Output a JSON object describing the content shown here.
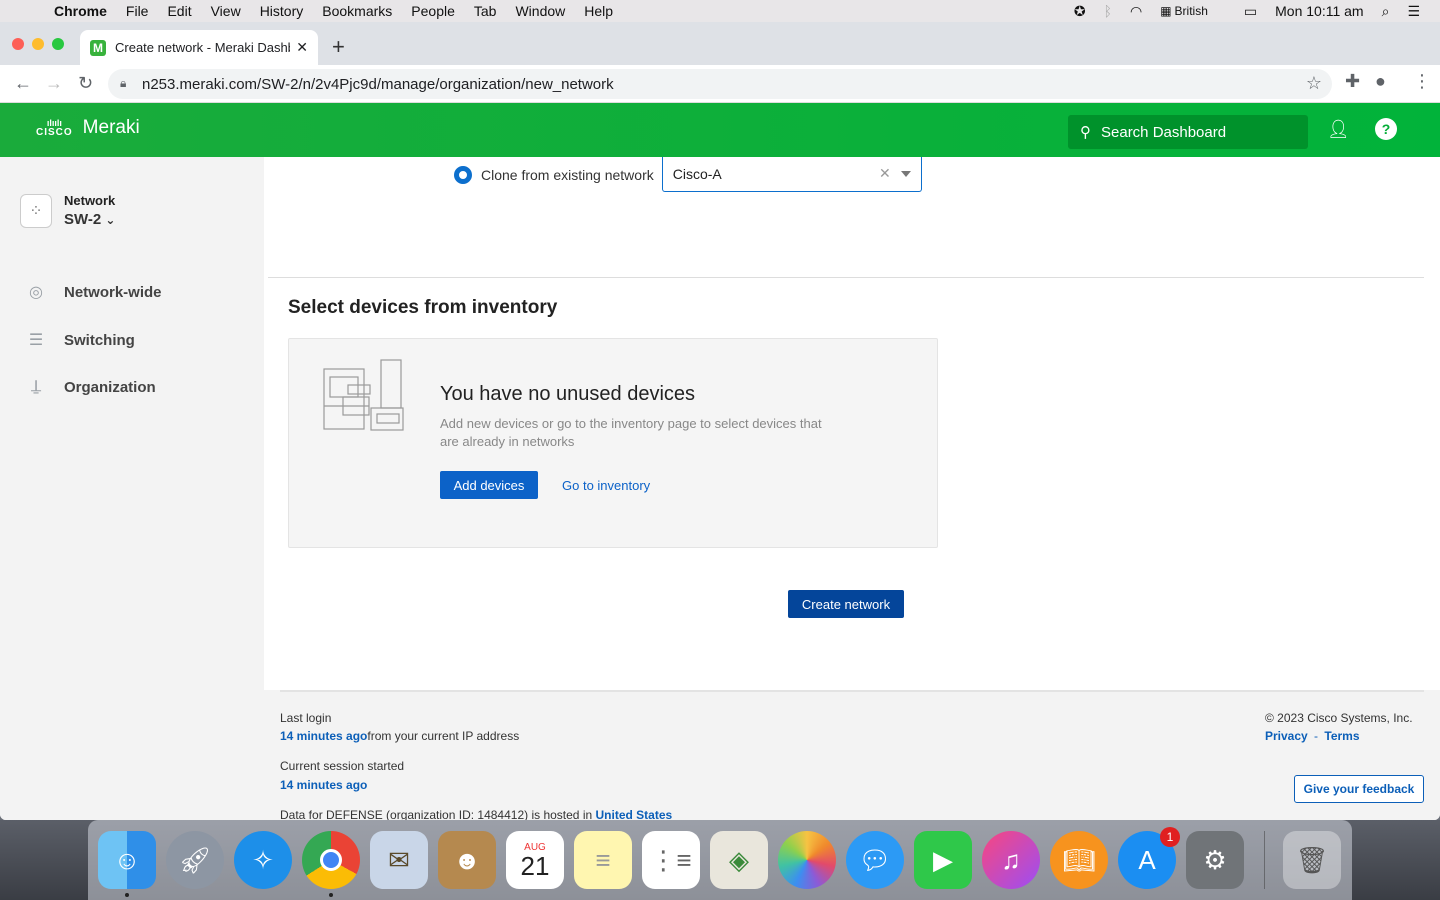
{
  "menubar": {
    "app": "Chrome",
    "items": [
      "File",
      "Edit",
      "View",
      "History",
      "Bookmarks",
      "People",
      "Tab",
      "Window",
      "Help"
    ],
    "input_source": "British",
    "clock": "Mon 10:11 am"
  },
  "browser": {
    "tab_title": "Create network - Meraki Dashboard",
    "favicon_letter": "M",
    "url": "n253.meraki.com/SW-2/n/2v4Pjc9d/manage/organization/new_network"
  },
  "header": {
    "brand_cisco": "CISCO",
    "brand_name": "Meraki",
    "search_placeholder": "Search Dashboard",
    "help_label": "?"
  },
  "sidebar": {
    "network_label": "Network",
    "network_name": "SW-2",
    "items": [
      {
        "label": "Network-wide",
        "icon": "globe-icon"
      },
      {
        "label": "Switching",
        "icon": "switch-icon"
      },
      {
        "label": "Organization",
        "icon": "organization-icon"
      }
    ]
  },
  "main": {
    "clone_label": "Clone from existing network",
    "clone_value": "Cisco-A",
    "section_title": "Select devices from inventory",
    "empty_title": "You have no unused devices",
    "empty_desc": "Add new devices or go to the inventory page to select devices that are already in networks",
    "add_devices": "Add devices",
    "go_inventory": "Go to inventory",
    "create_network": "Create network"
  },
  "footer": {
    "last_login_label": "Last login",
    "last_login_time": "14 minutes ago",
    "last_login_suffix": "from your current IP address",
    "session_label": "Current session started",
    "session_time": "14 minutes ago",
    "data_text": "Data for DEFENSE (organization ID: 1484412) is hosted in ",
    "data_region": "United States",
    "copyright": "© 2023 Cisco Systems, Inc.",
    "privacy": "Privacy",
    "sep": "-",
    "terms": "Terms",
    "feedback": "Give your feedback"
  },
  "dock": {
    "calendar_month": "AUG",
    "calendar_day": "21",
    "appstore_badge": "1",
    "apps": [
      "Finder",
      "Launchpad",
      "Safari",
      "Chrome",
      "Mail",
      "Contacts",
      "Calendar",
      "Notes",
      "Reminders",
      "Maps",
      "Photos",
      "Messages",
      "FaceTime",
      "iTunes",
      "Books",
      "App Store",
      "System Preferences",
      "Trash"
    ]
  },
  "colors": {
    "meraki_green": "#01b33a",
    "primary_blue": "#0c62c8",
    "dark_blue": "#04459a"
  }
}
